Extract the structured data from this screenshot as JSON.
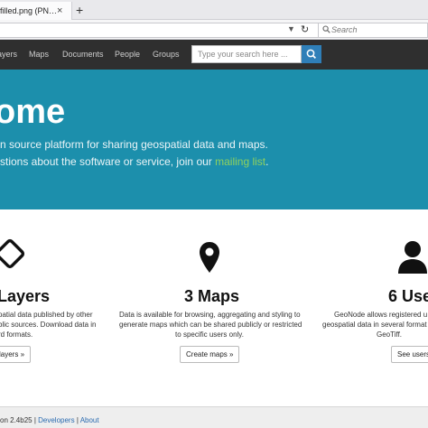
{
  "browser": {
    "tab_title": "filled.png (PN…",
    "tab_close": "×",
    "new_tab": "+",
    "url_dropdown": "▼",
    "reload": "↻",
    "search_placeholder": "Search"
  },
  "nav": {
    "items": [
      "ayers",
      "Maps",
      "Documents",
      "People",
      "Groups"
    ],
    "search_placeholder": "Type your search here ..."
  },
  "hero": {
    "title": "ome",
    "line1": "n source platform for sharing geospatial data and maps.",
    "line2_prefix": "stions about the software or service, join our ",
    "line2_link": "mailing list",
    "line2_suffix": "."
  },
  "features": [
    {
      "icon": "layers-icon",
      "title": "Layers",
      "desc": [
        "patial data published by other",
        "blic sources. Download data in",
        "rd formats."
      ],
      "button": "layers »"
    },
    {
      "icon": "map-marker-icon",
      "title": "3 Maps",
      "desc": [
        "Data is available for browsing, aggregating and styling to",
        "generate maps which can be shared publicly or restricted",
        "to specific users only."
      ],
      "button": "Create maps »"
    },
    {
      "icon": "user-icon",
      "title": "6 Use",
      "desc": [
        "GeoNode allows registered u",
        "geospatial data in several format",
        "GeoTiff."
      ],
      "button": "See users"
    }
  ],
  "footer": {
    "version": "on 2.4b25",
    "sep1": " | ",
    "developers": "Developers",
    "sep2": " | ",
    "about": "About"
  },
  "colors": {
    "hero_bg": "#1c8fac",
    "nav_bg": "#2f2f2f",
    "link_green": "#8fd15e",
    "search_btn": "#2f7fb8"
  }
}
